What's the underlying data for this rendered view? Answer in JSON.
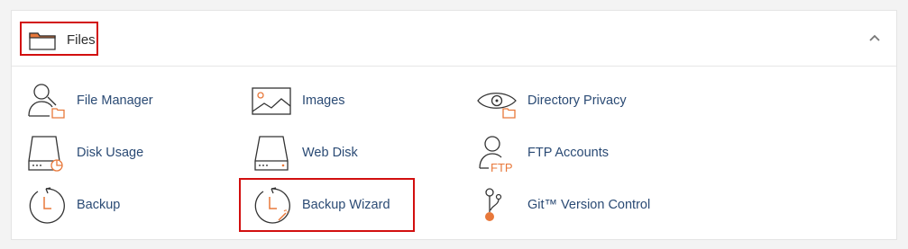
{
  "section": {
    "title": "Files",
    "icon": "folder-icon",
    "collapse_icon": "chevron-up-icon",
    "highlight_color": "#d20f0f",
    "accent_color": "#e8783a"
  },
  "items": [
    {
      "label": "File Manager",
      "icon": "file-manager-icon"
    },
    {
      "label": "Images",
      "icon": "images-icon"
    },
    {
      "label": "Directory Privacy",
      "icon": "directory-privacy-icon"
    },
    {
      "label": "Disk Usage",
      "icon": "disk-usage-icon"
    },
    {
      "label": "Web Disk",
      "icon": "web-disk-icon"
    },
    {
      "label": "FTP Accounts",
      "icon": "ftp-accounts-icon"
    },
    {
      "label": "Backup",
      "icon": "backup-icon"
    },
    {
      "label": "Backup Wizard",
      "icon": "backup-wizard-icon"
    },
    {
      "label": "Git™ Version Control",
      "icon": "git-version-control-icon"
    }
  ],
  "ftp_icon_text": "FTP"
}
